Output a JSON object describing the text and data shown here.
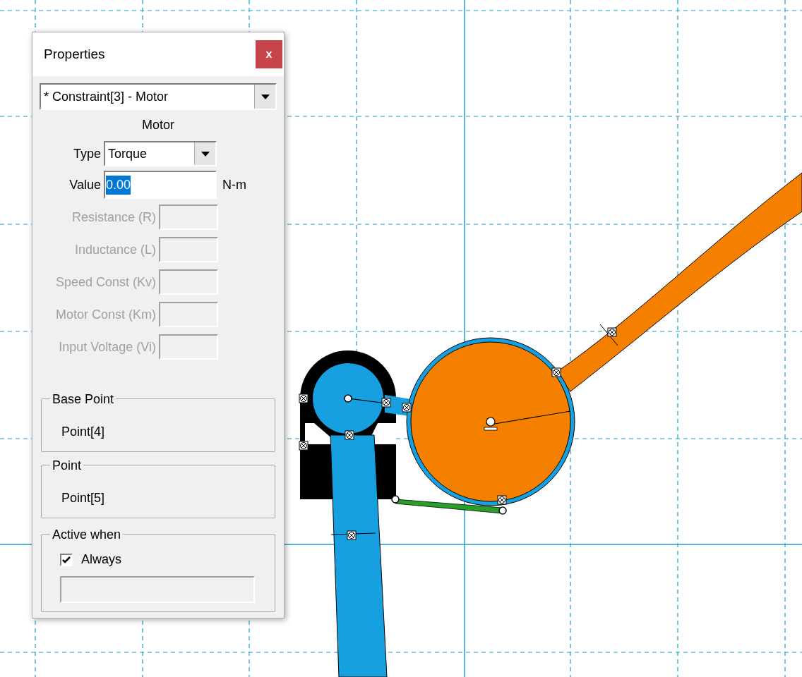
{
  "window": {
    "title": "Properties",
    "close": "x"
  },
  "object_select": {
    "value": "* Constraint[3] - Motor"
  },
  "section_title": "Motor",
  "fields": [
    {
      "label": "Type",
      "kind": "dropdown",
      "value": "Torque"
    },
    {
      "label": "Value",
      "kind": "number",
      "value": "0.00",
      "unit": "N-m",
      "text_selected": true
    },
    {
      "label": "Resistance (R)",
      "kind": "param",
      "disabled": true
    },
    {
      "label": "Inductance (L)",
      "kind": "param",
      "disabled": true
    },
    {
      "label": "Speed Const (Kv)",
      "kind": "param",
      "disabled": true
    },
    {
      "label": "Motor Const (Km)",
      "kind": "param",
      "disabled": true
    },
    {
      "label": "Input Voltage (Vi)",
      "kind": "param",
      "disabled": true
    }
  ],
  "groups": [
    {
      "title": "Base Point",
      "value": "Point[4]"
    },
    {
      "title": "Point",
      "value": "Point[5]"
    }
  ],
  "active_when": {
    "title": "Active when",
    "checkbox": {
      "label": "Always",
      "checked": true
    }
  }
}
